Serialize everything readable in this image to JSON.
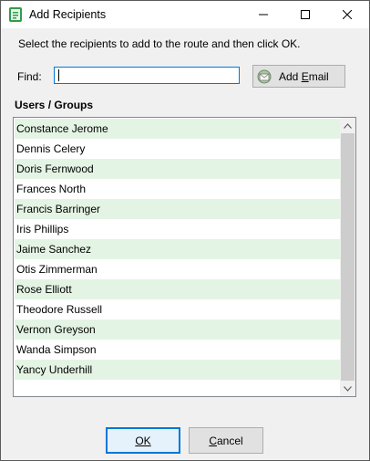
{
  "window": {
    "title": "Add Recipients",
    "icon": "app-document-icon",
    "controls": [
      "minimize-icon",
      "maximize-icon",
      "close-icon"
    ]
  },
  "instructions": "Select the recipients to add to the route and then click OK.",
  "find": {
    "label": "Find:",
    "value": ""
  },
  "add_email_button": {
    "label_prefix": "Add ",
    "label_accel": "E",
    "label_suffix": "mail",
    "icon": "email-icon"
  },
  "users_groups": {
    "header": "Users / Groups",
    "items": [
      "Constance Jerome",
      "Dennis Celery",
      "Doris Fernwood",
      "Frances North",
      "Francis Barringer",
      "Iris Phillips",
      "Jaime Sanchez",
      "Otis Zimmerman",
      "Rose Elliott",
      "Theodore Russell",
      "Vernon Greyson",
      "Wanda Simpson",
      "Yancy Underhill"
    ]
  },
  "ok_button": {
    "label": "OK"
  },
  "cancel_button": {
    "label_accel": "C",
    "label_rest": "ancel"
  },
  "colors": {
    "alt_row": "#e4f4e4",
    "focus": "#0078d7",
    "button_face": "#e1e1e1"
  }
}
